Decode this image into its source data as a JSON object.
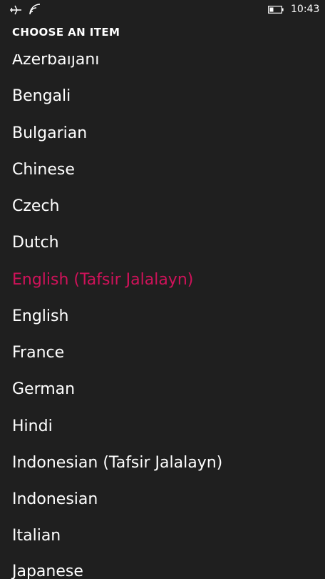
{
  "status_bar": {
    "time": "10:43",
    "icons": [
      "airplane-icon",
      "wifi-icon",
      "battery-icon"
    ]
  },
  "title": "CHOOSE AN ITEM",
  "accent_color": "#d0125a",
  "items": [
    {
      "label": "Azerbaijani",
      "selected": false
    },
    {
      "label": "Bengali",
      "selected": false
    },
    {
      "label": "Bulgarian",
      "selected": false
    },
    {
      "label": "Chinese",
      "selected": false
    },
    {
      "label": "Czech",
      "selected": false
    },
    {
      "label": "Dutch",
      "selected": false
    },
    {
      "label": "English (Tafsir Jalalayn)",
      "selected": true
    },
    {
      "label": "English",
      "selected": false
    },
    {
      "label": "France",
      "selected": false
    },
    {
      "label": "German",
      "selected": false
    },
    {
      "label": "Hindi",
      "selected": false
    },
    {
      "label": "Indonesian (Tafsir Jalalayn)",
      "selected": false
    },
    {
      "label": "Indonesian",
      "selected": false
    },
    {
      "label": "Italian",
      "selected": false
    },
    {
      "label": "Japanese",
      "selected": false
    }
  ]
}
